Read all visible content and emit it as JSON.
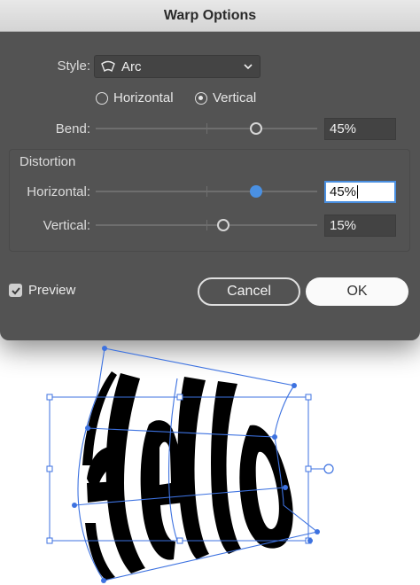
{
  "window": {
    "title": "Warp Options"
  },
  "style": {
    "label": "Style:",
    "value": "Arc",
    "icon": "arc-warp-icon"
  },
  "orientation": {
    "horizontal_label": "Horizontal",
    "vertical_label": "Vertical",
    "selected": "Vertical"
  },
  "bend": {
    "label": "Bend:",
    "value": "45%",
    "level": 0.725
  },
  "distortion": {
    "title": "Distortion",
    "horizontal": {
      "label": "Horizontal:",
      "value": "45%",
      "level": 0.725
    },
    "vertical": {
      "label": "Vertical:",
      "value": "15%",
      "level": 0.575
    }
  },
  "preview": {
    "label": "Preview",
    "checked": true
  },
  "buttons": {
    "cancel": "Cancel",
    "ok": "OK"
  },
  "colors": {
    "accent": "#4A90E2",
    "dialog_bg": "#535353",
    "selection": "#3D72E0"
  }
}
